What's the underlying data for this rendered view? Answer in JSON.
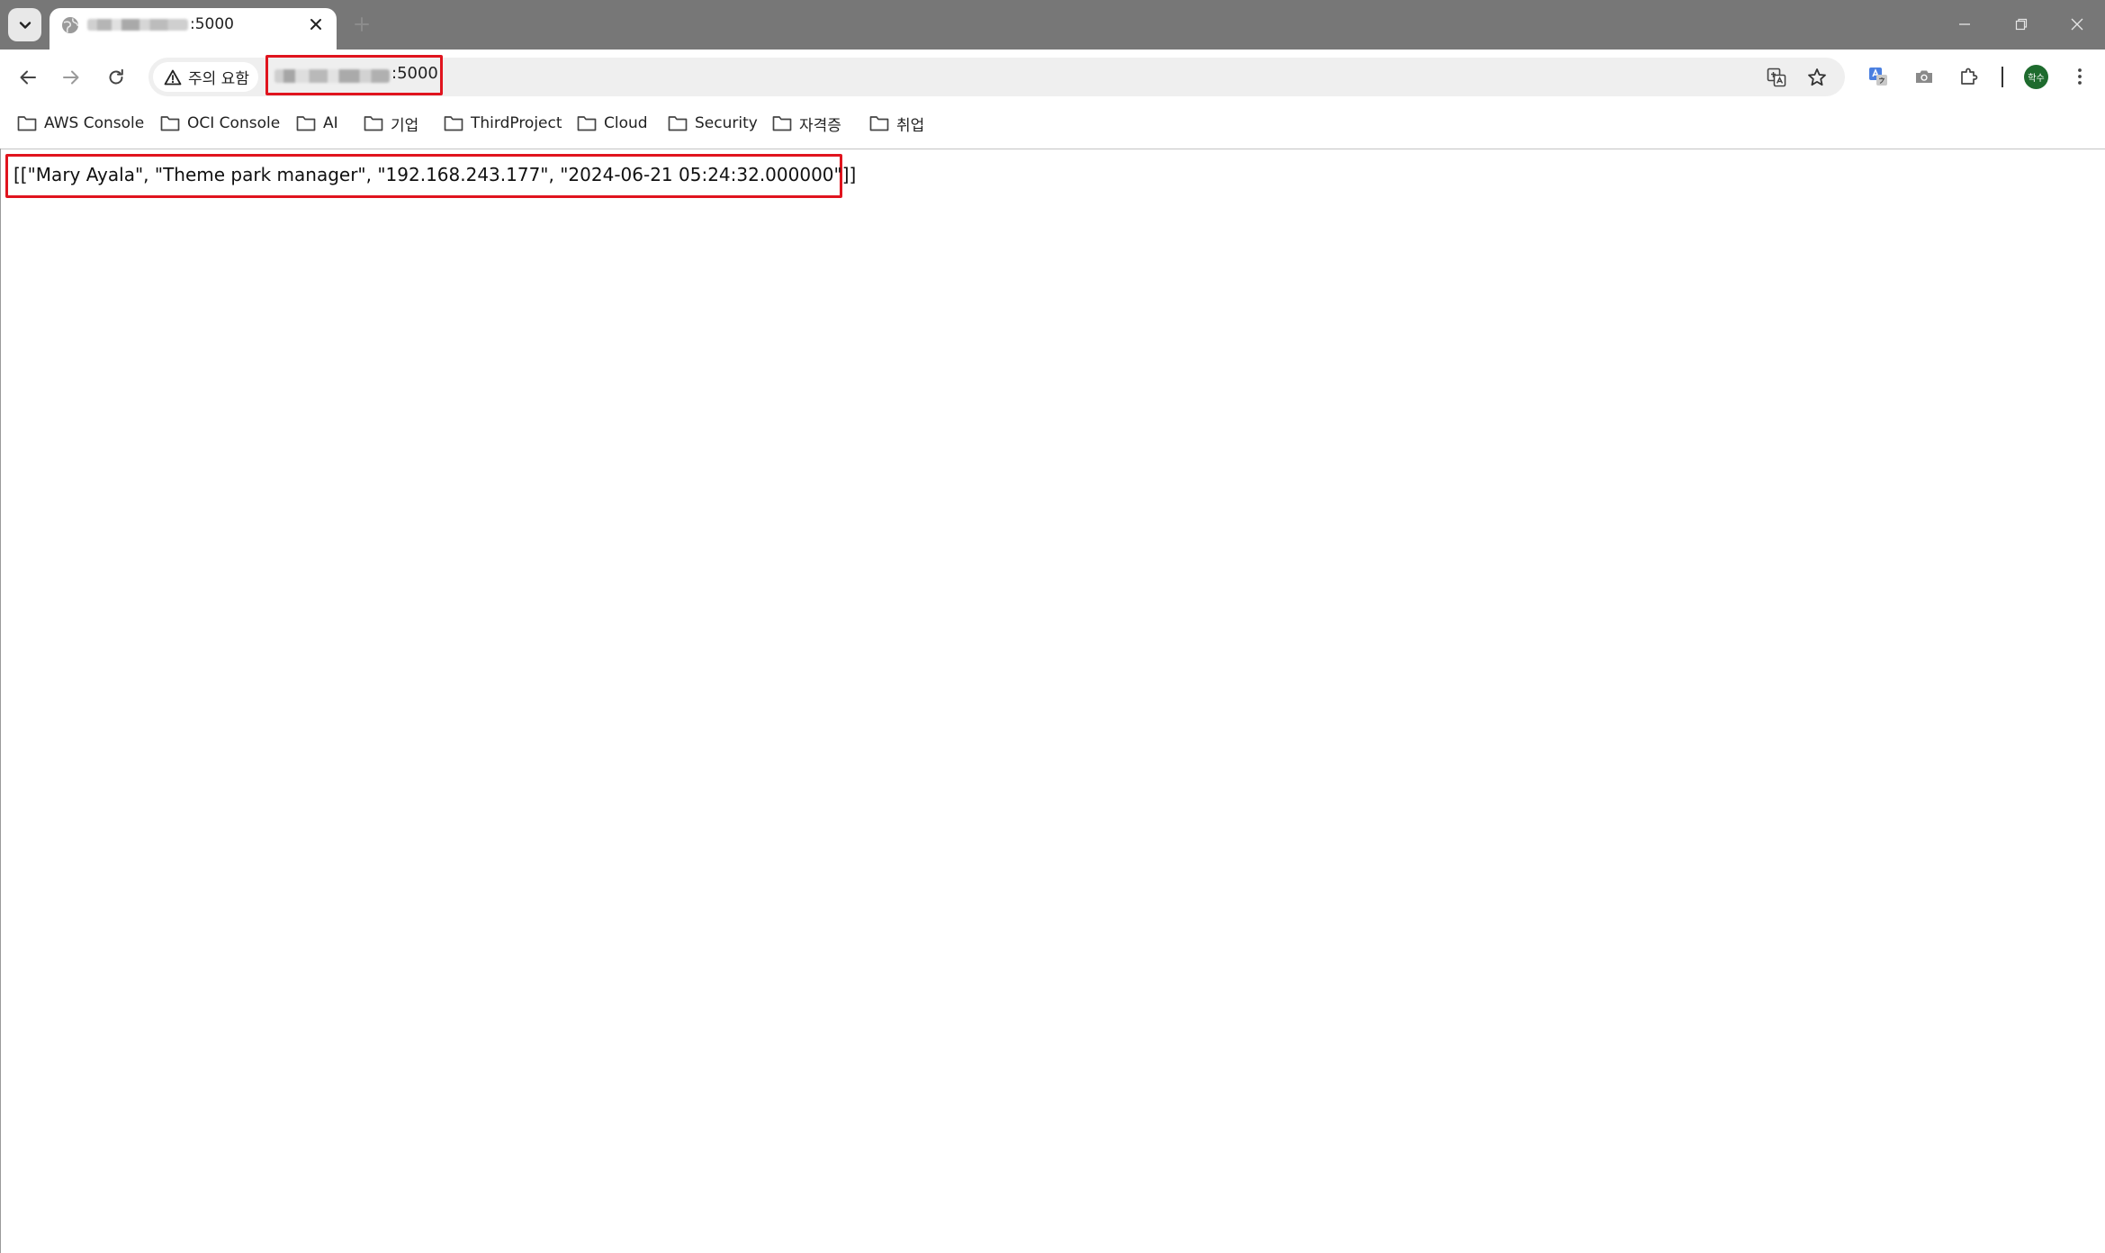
{
  "browser": {
    "tab": {
      "title_suffix": ":5000"
    },
    "address_bar": {
      "security_label": "주의 요함",
      "url_suffix": ":5000"
    },
    "profile": {
      "initials": "학수",
      "color": "#1e6b2e"
    },
    "highlight_color": "#e0141e"
  },
  "bookmarks": [
    {
      "label": "AWS Console"
    },
    {
      "label": "OCI Console"
    },
    {
      "label": "AI"
    },
    {
      "label": "기업"
    },
    {
      "label": "ThirdProject"
    },
    {
      "label": "Cloud"
    },
    {
      "label": "Security"
    },
    {
      "label": "자격증"
    },
    {
      "label": "취업"
    }
  ],
  "page": {
    "json_text": "[[\"Mary Ayala\", \"Theme park manager\", \"192.168.243.177\", \"2024-06-21 05:24:32.000000\"]]"
  }
}
